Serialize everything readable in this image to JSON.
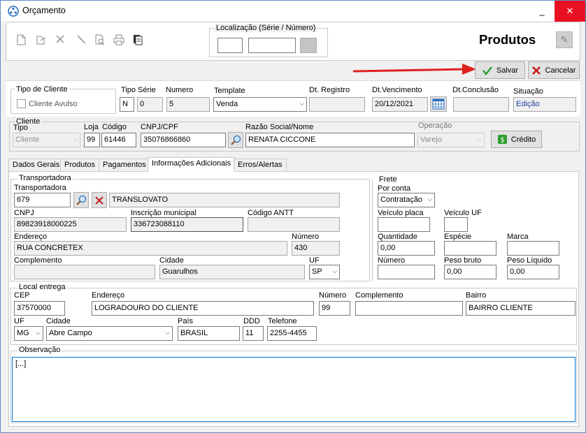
{
  "window": {
    "title": "Orçamento",
    "controls": {
      "minimize": "_",
      "maximize": "□",
      "close": "✕"
    }
  },
  "toolbar": {
    "localizacao_label": "Localização (Série / Número)",
    "serie_value": "",
    "numero_value": "",
    "section_title": "Produtos",
    "salvar_label": "Salvar",
    "cancelar_label": "Cancelar"
  },
  "header": {
    "tipo_cliente_label": "Tipo de Cliente",
    "cliente_avulso_label": "Cliente Avulso",
    "tipo_serie_label": "Tipo Série",
    "tipo_serie_a": "N",
    "tipo_serie_b": "0",
    "numero_label": "Numero",
    "numero_value": "5",
    "template_label": "Template",
    "template_value": "Venda",
    "dt_registro_label": "Dt. Registro",
    "dt_registro_value": "",
    "dt_vencimento_label": "Dt.Vencimento",
    "dt_vencimento_value": "20/12/2021",
    "dt_conclusao_label": "Dt.Conclusão",
    "dt_conclusao_value": "",
    "situacao_label": "Situação",
    "situacao_value": "Edição"
  },
  "cliente": {
    "legend": "Cliente",
    "tipo_label": "Tipo",
    "tipo_value": "Cliente",
    "loja_label": "Loja",
    "loja_value": "99",
    "codigo_label": "Código",
    "codigo_value": "61446",
    "cnpj_label": "CNPJ/CPF",
    "cnpj_value": "35076866860",
    "razao_label": "Razão Social/Nome",
    "razao_value": "RENATA CICCONE",
    "operacao_label": "Operação",
    "operacao_value": "Varejo",
    "credito_label": "Crédito"
  },
  "tabs": [
    {
      "label": "Dados Gerais"
    },
    {
      "label": "Produtos"
    },
    {
      "label": "Pagamentos"
    },
    {
      "label": "Informações Adicionais"
    },
    {
      "label": "Erros/Alertas"
    }
  ],
  "transportadora": {
    "legend": "Transportadora",
    "label": "Transportadora",
    "codigo_value": "679",
    "nome_value": "TRANSLOVATO",
    "cnpj_label": "CNPJ",
    "cnpj_value": "89823918000225",
    "insc_label": "Inscrição municipal",
    "insc_value": "336723088110",
    "antt_label": "Código ANTT",
    "antt_value": "",
    "endereco_label": "Endereço",
    "endereco_value": "RUA CONCRETEX",
    "numero_label": "Número",
    "numero_value": "430",
    "complemento_label": "Complemento",
    "complemento_value": "",
    "cidade_label": "Cidade",
    "cidade_value": "Guarulhos",
    "uf_label": "UF",
    "uf_value": "SP"
  },
  "frete": {
    "legend": "Frete",
    "por_conta_label": "Por conta",
    "por_conta_value": "Contratação",
    "veiculo_placa_label": "Veículo placa",
    "veiculo_placa_value": "",
    "veiculo_uf_label": "Veículo UF",
    "veiculo_uf_value": "",
    "quantidade_label": "Quantidade",
    "quantidade_value": "0,00",
    "especie_label": "Espécie",
    "especie_value": "",
    "marca_label": "Marca",
    "marca_value": "",
    "numero_label": "Número",
    "numero_value": "",
    "peso_bruto_label": "Peso bruto",
    "peso_bruto_value": "0,00",
    "peso_liquido_label": "Peso Líquido",
    "peso_liquido_value": "0,00"
  },
  "local_entrega": {
    "legend": "Local entrega",
    "cep_label": "CEP",
    "cep_value": "37570000",
    "endereco_label": "Endereço",
    "endereco_value": "LOGRADOURO DO CLIENTE",
    "numero_label": "Número",
    "numero_value": "99",
    "complemento_label": "Complemento",
    "complemento_value": "",
    "bairro_label": "Bairro",
    "bairro_value": "BAIRRO CLIENTE",
    "uf_label": "UF",
    "uf_value": "MG",
    "cidade_label": "Cidade",
    "cidade_value": "Abre Campo",
    "pais_label": "País",
    "pais_value": "BRASIL",
    "ddd_label": "DDD",
    "ddd_value": "11",
    "telefone_label": "Telefone",
    "telefone_value": "2255-4455"
  },
  "observacao": {
    "legend": "Observação",
    "value": "[...]"
  },
  "colors": {
    "accent": "#0078d7",
    "arrow": "#e02020",
    "close": "#e81123"
  }
}
